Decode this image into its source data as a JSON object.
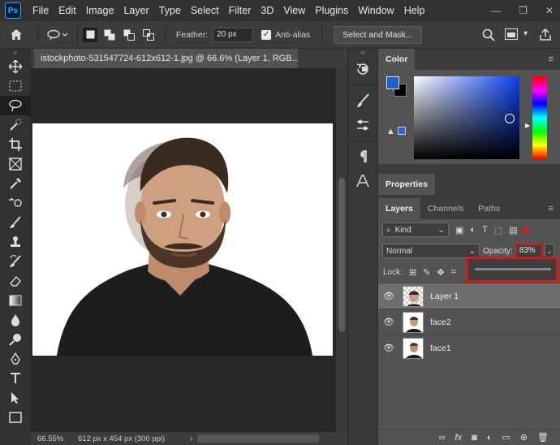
{
  "app": {
    "logo": "Ps"
  },
  "menu": [
    "File",
    "Edit",
    "Image",
    "Layer",
    "Type",
    "Select",
    "Filter",
    "3D",
    "View",
    "Plugins",
    "Window",
    "Help"
  ],
  "window_controls": [
    "minimize-icon",
    "maximize-icon",
    "close-icon"
  ],
  "options_bar": {
    "feather_label": "Feather:",
    "feather_value": "20 px",
    "antialias_label": "Anti-alias",
    "antialias_checked": true,
    "select_mask_label": "Select and Mask..."
  },
  "document": {
    "tab_title": "istockphoto-531547724-612x612-1.jpg @ 66.6% (Layer 1, RGB...",
    "zoom": "66.55%",
    "doc_info": "612 px x 454 px (300 ppi)"
  },
  "colors": {
    "foreground": "#1a5fd1",
    "background": "#000000",
    "accent_highlight": "#d21a1a"
  },
  "panels": {
    "color_tab": "Color",
    "properties_tab": "Properties",
    "tabs": [
      "Layers",
      "Channels",
      "Paths"
    ]
  },
  "layers_panel": {
    "kind_label": "Kind",
    "blend_mode": "Normal",
    "opacity_label": "Opacity:",
    "opacity_value": "83%",
    "lock_label": "Lock:",
    "layers": [
      {
        "name": "Layer 1",
        "selected": true,
        "visible": true
      },
      {
        "name": "face2",
        "selected": false,
        "visible": true
      },
      {
        "name": "face1",
        "selected": false,
        "visible": true
      }
    ]
  }
}
